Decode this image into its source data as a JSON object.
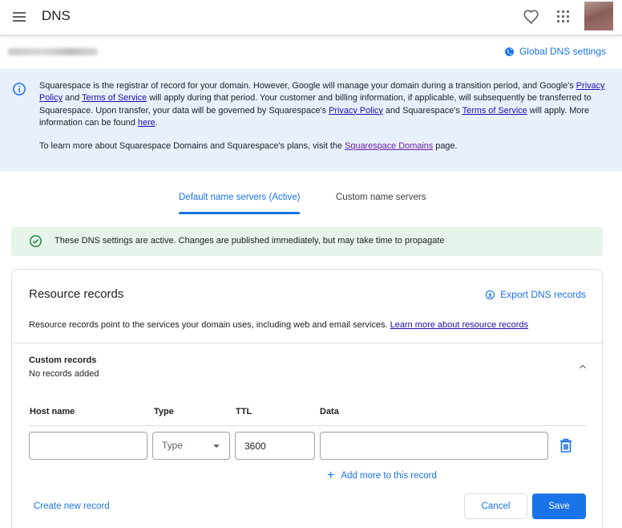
{
  "header": {
    "title": "DNS",
    "menu_icon": "hamburger-menu-icon",
    "favorite_icon": "heart-icon",
    "apps_icon": "apps-grid-icon"
  },
  "domain_bar": {
    "global_dns_label": "Global DNS settings"
  },
  "info_banner": {
    "p1_t1": "Squarespace is the registrar of record for your domain. However, Google will manage your domain during a transition period, and Google's ",
    "p1_l1": "Privacy Policy",
    "p1_t2": " and ",
    "p1_l2": "Terms of Service",
    "p1_t3": " will apply during that period. Your customer and billing information, if applicable, will subsequently be transferred to Squarespace. Upon transfer, your data will be governed by Squarespace's ",
    "p1_l3": "Privacy Policy",
    "p1_t4": " and Squarespace's ",
    "p1_l4": "Terms of Service",
    "p1_t5": " will apply. More information can be found ",
    "p1_l5": "here",
    "p1_t6": ".",
    "p2_t1": "To learn more about Squarespace Domains and Squarespace's plans, visit the ",
    "p2_l1": "Squarespace Domains",
    "p2_t2": " page."
  },
  "tabs": [
    {
      "label": "Default name servers (Active)",
      "active": true
    },
    {
      "label": "Custom name servers",
      "active": false
    }
  ],
  "status_banner": {
    "text": "These DNS settings are active. Changes are published immediately, but may take time to propagate"
  },
  "resource_records": {
    "title": "Resource records",
    "export_label": "Export DNS records",
    "desc": "Resource records point to the services your domain uses, including web and email services. ",
    "learn_more": "Learn more about resource records",
    "custom_title": "Custom records",
    "custom_sub": "No records added",
    "columns": [
      "Host name",
      "Type",
      "TTL",
      "Data"
    ],
    "form": {
      "host_value": "",
      "type_value": "Type",
      "ttl_value": "3600",
      "data_value": ""
    },
    "add_more": "Add more to this record",
    "create_new": "Create new record",
    "cancel": "Cancel",
    "save": "Save"
  },
  "colors": {
    "accent": "#1a73e8",
    "info_bg": "#e8f0fe",
    "success_bg": "#e6f4ea",
    "success_icon": "#188038"
  }
}
